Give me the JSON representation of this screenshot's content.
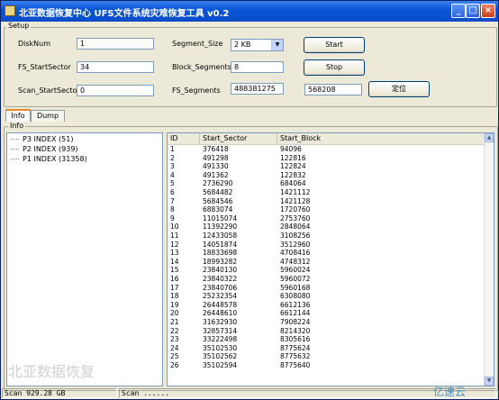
{
  "window": {
    "title": "北亚数据恢复中心 UFS文件系统灾难恢复工具 v0.2"
  },
  "setup": {
    "group_label": "Setup",
    "disknum_label": "DiskNum",
    "disknum_value": "1",
    "fs_startsector_label": "FS_StartSector",
    "fs_startsector_value": "34",
    "scan_startsector_label": "Scan_StartSector",
    "scan_startsector_value": "0",
    "segment_size_label": "Segment_Size",
    "segment_size_value": "2 KB",
    "block_segments_label": "Block_Segments",
    "block_segments_value": "8",
    "fs_segments_label": "FS_Segments",
    "fs_segments_value": "488381275",
    "start_label": "Start",
    "stop_label": "Stop",
    "locate_input_value": "568208",
    "locate_label": "定位"
  },
  "tabs": [
    {
      "label": "Info"
    },
    {
      "label": "Dump"
    }
  ],
  "info_group_label": "Info",
  "tree": [
    {
      "label": "P3 INDEX (51)"
    },
    {
      "label": "P2 INDEX (939)"
    },
    {
      "label": "P1 INDEX (31358)"
    }
  ],
  "table": {
    "columns": [
      "ID",
      "Start_Sector",
      "Start_Block"
    ],
    "rows": [
      [
        "1",
        "376418",
        "94096"
      ],
      [
        "2",
        "491298",
        "122816"
      ],
      [
        "3",
        "491330",
        "122824"
      ],
      [
        "4",
        "491362",
        "122832"
      ],
      [
        "5",
        "2736290",
        "684064"
      ],
      [
        "6",
        "5684482",
        "1421112"
      ],
      [
        "7",
        "5684546",
        "1421128"
      ],
      [
        "8",
        "6883074",
        "1720760"
      ],
      [
        "9",
        "11015074",
        "2753760"
      ],
      [
        "10",
        "11392290",
        "2848064"
      ],
      [
        "11",
        "12433058",
        "3108256"
      ],
      [
        "12",
        "14051874",
        "3512960"
      ],
      [
        "13",
        "18833698",
        "4708416"
      ],
      [
        "14",
        "18993282",
        "4748312"
      ],
      [
        "15",
        "23840130",
        "5960024"
      ],
      [
        "16",
        "23840322",
        "5960072"
      ],
      [
        "17",
        "23840706",
        "5960168"
      ],
      [
        "18",
        "25232354",
        "6308080"
      ],
      [
        "19",
        "26448578",
        "6612136"
      ],
      [
        "20",
        "26448610",
        "6612144"
      ],
      [
        "21",
        "31632930",
        "7908224"
      ],
      [
        "22",
        "32857314",
        "8214320"
      ],
      [
        "23",
        "33222498",
        "8305616"
      ],
      [
        "24",
        "35102530",
        "8775624"
      ],
      [
        "25",
        "35102562",
        "8775632"
      ],
      [
        "26",
        "35102594",
        "8775640"
      ]
    ]
  },
  "status": {
    "left": "Scan 929.28 GB",
    "right": "Scan ......"
  },
  "watermark": {
    "text": "北亚数据恢复",
    "brand": "亿速云"
  }
}
